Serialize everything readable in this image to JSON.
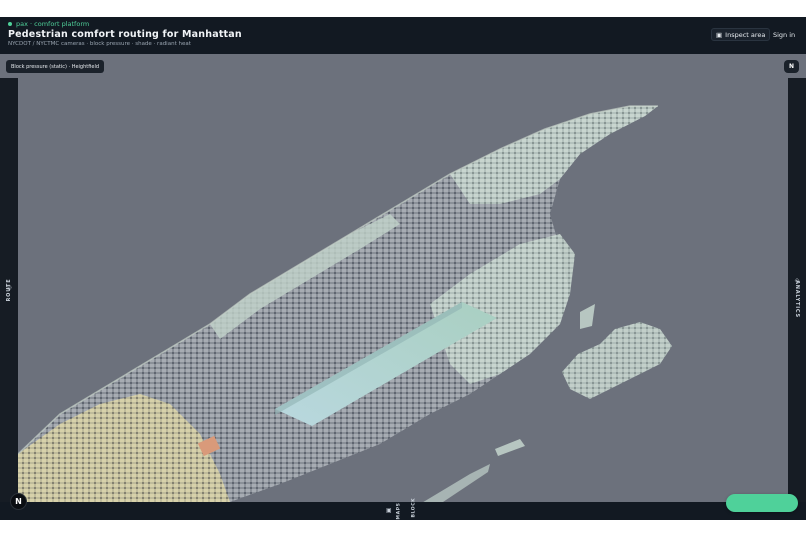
{
  "header": {
    "brand": "pax · comfort platform",
    "title": "Pedestrian comfort routing for Manhattan",
    "subtitle": "NYCDOT / NYCTMC cameras · block pressure · shade · radiant heat",
    "inspect_icon": "inspect-square-icon",
    "inspect_label": "Inspect area",
    "signin_label": "Sign in"
  },
  "map": {
    "layer_chip": "Block pressure (static) · Heightfield",
    "compass_label": "N",
    "colors": {
      "background": "#6c717c",
      "buildings": "#8d939c",
      "park": "#9fc9c6",
      "low_pressure": "#b9d7d9",
      "mid_pressure": "#d8d2a8",
      "high_pressure": "#d99a7a"
    }
  },
  "left_rail": {
    "icon": "route-target-icon",
    "label": "ROUTE"
  },
  "right_rail": {
    "icon": "analytics-diamond-icon",
    "label": "ANALYTICS"
  },
  "bottom_bar": {
    "icon": "maps-square-icon",
    "label_1": "MAPS",
    "label_2": "& BLOCK"
  },
  "badge": {
    "label": "N"
  }
}
